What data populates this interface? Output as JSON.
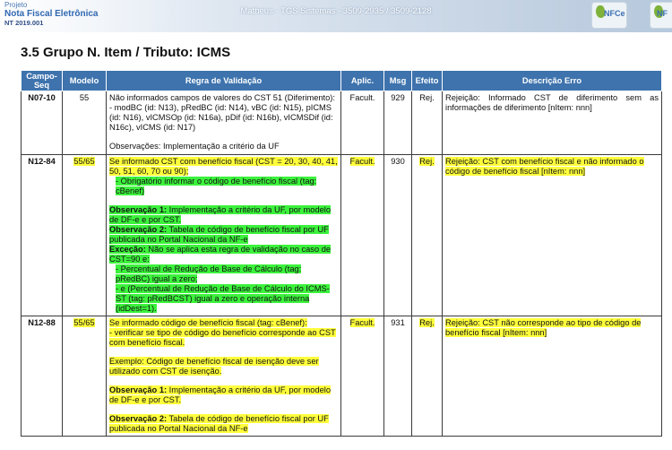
{
  "header": {
    "project_label": "Projeto",
    "product_name": "Nota Fiscal Eletrônica",
    "doc_code": "NT 2019.001",
    "window_title": "Matheus - TGS Sistemas - 3509-2935 / 3509-2128",
    "logo1_text": "NFCe",
    "logo2_text": "NF"
  },
  "section": {
    "title": "3.5  Grupo N. Item / Tributo: ICMS"
  },
  "table": {
    "headers": {
      "campo": "Campo-Seq",
      "modelo": "Modelo",
      "regra": "Regra de Validação",
      "aplic": "Aplic.",
      "msg": "Msg",
      "efeito": "Efeito",
      "erro": "Descrição Erro"
    },
    "rows": [
      {
        "campo": "N07-10",
        "modelo": "55",
        "aplic": "Facult.",
        "msg": "929",
        "efeito": "Rej.",
        "erro": "Rejeição: Informado CST de diferimento sem as informações de diferimento [nItem: nnn]",
        "rule": {
          "text": "Não informados campos de valores do CST 51 (Diferimento): - modBC (id: N13), pRedBC (id: N14), vBC (id: N15), pICMS (id: N16), vICMSOp (id: N16a), pDif (id: N16b), vICMSDif (id: N16c), vICMS (id: N17)",
          "obs": "Observações: Implementação a critério da UF"
        }
      },
      {
        "campo": "N12-84",
        "modelo": "55/65",
        "aplic": "Facult.",
        "msg": "930",
        "efeito": "Rej.",
        "erro": "Rejeição: CST com benefício fiscal e não informado o código de benefício fiscal [nItem: nnn]",
        "rule": {
          "line1": "Se informado CST com benefício fiscal (CST = 20, 30, 40, 41, 50, 51, 60, 70 ou 90);",
          "line2": "- Obrigatório informar o código de benefício fiscal (tag: cBenef)",
          "obs1_label": "Observação 1:",
          "obs1_text": " Implementação a critério da UF, por modelo de DF-e e por CST.",
          "obs2_label": "Observação 2:",
          "obs2_text": " Tabela de código de benefício fiscal por UF publicada no Portal Nacional da NF-e",
          "exc_label": "Exceção:",
          "exc_text": " Não se aplica esta regra de validação no caso de CST=90 e:",
          "exc1": "- Percentual de Redução de Base de Cálculo (tag: pRedBC) igual a zero;",
          "exc2": "- e (Percentual de Redução de Base de Cálculo do ICMS-ST (tag: pRedBCST) igual a zero e operação interna (idDest=1)."
        }
      },
      {
        "campo": "N12-88",
        "modelo": "55/65",
        "aplic": "Facult.",
        "msg": "931",
        "efeito": "Rej.",
        "erro": "Rejeição: CST não corresponde ao tipo de código de benefício fiscal [nItem: nnn]",
        "rule": {
          "line1": "Se informado código de benefício fiscal (tag: cBenef):",
          "line2": "- verificar se tipo de código do benefício corresponde ao CST com benefício fiscal.",
          "example": "Exemplo: Código de benefício fiscal de isenção deve ser utilizado com CST de isenção.",
          "obs1_label": "Observação 1:",
          "obs1_text": " Implementação a critério da UF, por modelo de DF-e e por CST.",
          "obs2_label": "Observação 2:",
          "obs2_text": " Tabela de código de benefício fiscal por UF publicada no Portal Nacional da NF-e"
        }
      }
    ]
  }
}
